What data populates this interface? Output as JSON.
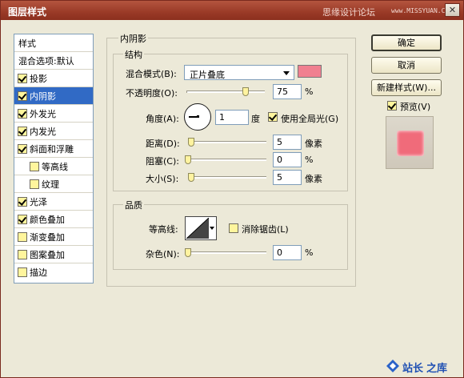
{
  "window": {
    "title": "图层样式",
    "watermark": "思缘设计论坛",
    "watermark_url": "www.MISSYUAN.COM",
    "close_icon": "close-icon"
  },
  "sidebar": {
    "items": [
      {
        "label": "样式",
        "checkbox": false,
        "checked": false,
        "selected": false,
        "indent": false
      },
      {
        "label": "混合选项:默认",
        "checkbox": false,
        "checked": false,
        "selected": false,
        "indent": false
      },
      {
        "label": "投影",
        "checkbox": true,
        "checked": true,
        "selected": false,
        "indent": false
      },
      {
        "label": "内阴影",
        "checkbox": true,
        "checked": true,
        "selected": true,
        "indent": false
      },
      {
        "label": "外发光",
        "checkbox": true,
        "checked": true,
        "selected": false,
        "indent": false
      },
      {
        "label": "内发光",
        "checkbox": true,
        "checked": true,
        "selected": false,
        "indent": false
      },
      {
        "label": "斜面和浮雕",
        "checkbox": true,
        "checked": true,
        "selected": false,
        "indent": false
      },
      {
        "label": "等高线",
        "checkbox": true,
        "checked": false,
        "selected": false,
        "indent": true
      },
      {
        "label": "纹理",
        "checkbox": true,
        "checked": false,
        "selected": false,
        "indent": true
      },
      {
        "label": "光泽",
        "checkbox": true,
        "checked": true,
        "selected": false,
        "indent": false
      },
      {
        "label": "颜色叠加",
        "checkbox": true,
        "checked": true,
        "selected": false,
        "indent": false
      },
      {
        "label": "渐变叠加",
        "checkbox": true,
        "checked": false,
        "selected": false,
        "indent": false
      },
      {
        "label": "图案叠加",
        "checkbox": true,
        "checked": false,
        "selected": false,
        "indent": false
      },
      {
        "label": "描边",
        "checkbox": true,
        "checked": false,
        "selected": false,
        "indent": false
      }
    ]
  },
  "inner_shadow": {
    "section_title": "内阴影",
    "structure": {
      "title": "结构",
      "blend_mode_label": "混合模式(B):",
      "blend_mode_value": "正片叠底",
      "blend_color": "#f08090",
      "opacity_label": "不透明度(O):",
      "opacity_value": "75",
      "opacity_percent": 75,
      "percent_unit": "%",
      "angle_label": "角度(A):",
      "angle_value": "1",
      "degree_unit": "度",
      "global_light_label": "使用全局光(G)",
      "global_light_checked": true,
      "distance_label": "距离(D):",
      "distance_value": "5",
      "choke_label": "阻塞(C):",
      "choke_value": "0",
      "size_label": "大小(S):",
      "size_value": "5",
      "pixel_unit": "像素"
    },
    "quality": {
      "title": "品质",
      "contour_label": "等高线:",
      "antialias_label": "消除锯齿(L)",
      "antialias_checked": false,
      "noise_label": "杂色(N):",
      "noise_value": "0",
      "percent_unit": "%"
    }
  },
  "buttons": {
    "ok": "确定",
    "cancel": "取消",
    "new_style": "新建样式(W)...",
    "preview_label": "预览(V)",
    "preview_checked": true
  },
  "footer_logo": {
    "text1": "站长",
    "text2": "之库"
  }
}
